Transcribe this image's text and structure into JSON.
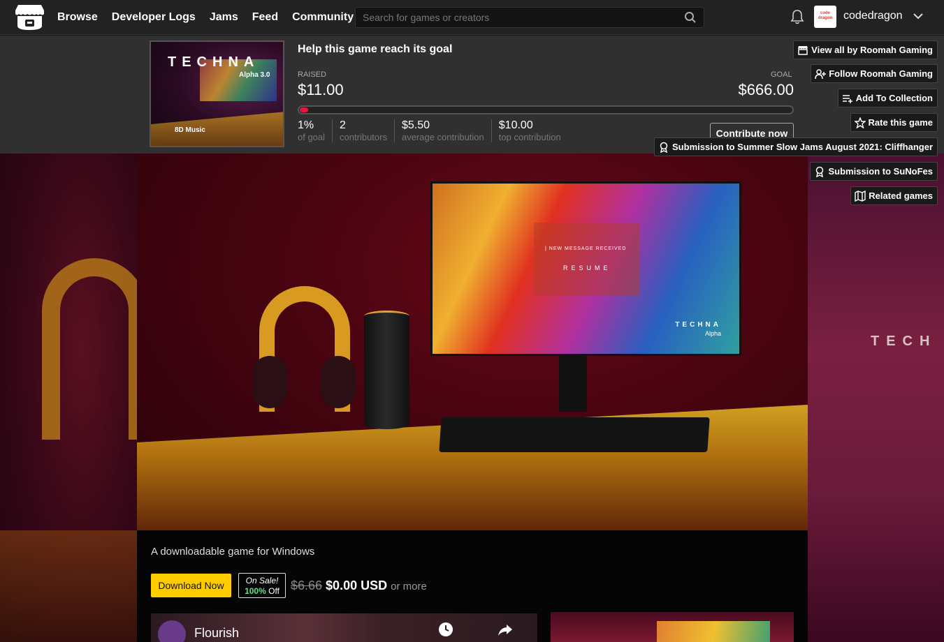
{
  "nav": {
    "links": [
      "Browse",
      "Developer Logs",
      "Jams",
      "Feed",
      "Community"
    ],
    "search_placeholder": "Search for games or creators",
    "username": "codedragon",
    "avatar_text": "code dragon"
  },
  "fund": {
    "title": "Help this game reach its goal",
    "raised_label": "RAISED",
    "raised": "$11.00",
    "goal_label": "GOAL",
    "goal": "$666.00",
    "progress_fraction": 0.0165,
    "stats": [
      {
        "value": "1%",
        "label": "of goal"
      },
      {
        "value": "2",
        "label": "contributors"
      },
      {
        "value": "$5.50",
        "label": "average contribution"
      },
      {
        "value": "$10.00",
        "label": "top contribution"
      }
    ],
    "contribute_label": "Contribute now"
  },
  "cover": {
    "title": "TECHNA",
    "subtitle": "Alpha 3.0",
    "badge": "8D Music"
  },
  "actions": {
    "view_all": "View all by Roomah Gaming",
    "follow": "Follow Roomah Gaming",
    "add_collection": "Add To Collection",
    "rate": "Rate this game",
    "submission_jam": "Submission to Summer Slow Jams August 2021: Cliffhanger",
    "submission_sunofes": "Submission to SuNoFes",
    "related": "Related games"
  },
  "hero": {
    "screen_message": "|  NEW MESSAGE RECEIVED",
    "screen_resume": "RESUME",
    "screen_brand": "TECHNA",
    "screen_alpha": "Alpha",
    "bg_right_text": "TECH"
  },
  "game": {
    "subtitle": "A downloadable game for Windows",
    "download_label": "Download Now",
    "sale_label": "On Sale!",
    "sale_percent": "100%",
    "sale_off": "Off",
    "old_price": "$6.66",
    "new_price": "$0.00 USD",
    "or_more": "or more",
    "video_title": "Flourish"
  }
}
